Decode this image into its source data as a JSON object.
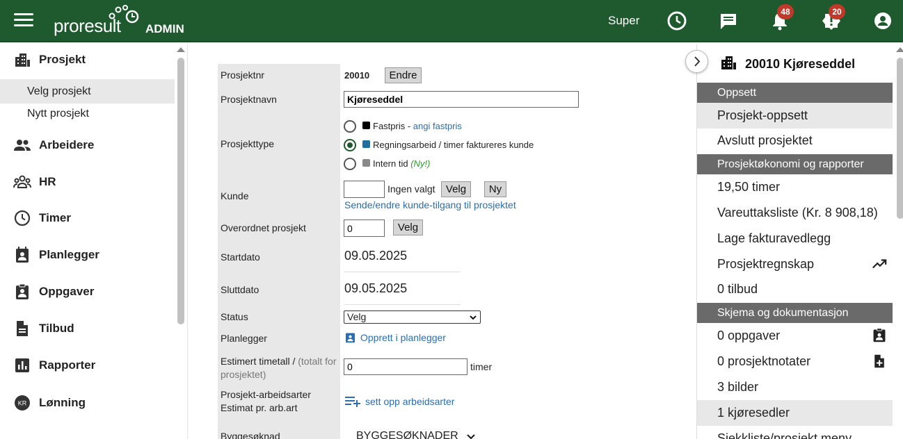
{
  "topbar": {
    "logo_text": "proresult",
    "logo_suffix": "ADMIN",
    "user": "Super",
    "notifications_count": "48",
    "alerts_count": "20"
  },
  "sidebar": {
    "items": [
      {
        "label": "Prosjekt",
        "icon": "building-icon"
      },
      {
        "label": "Arbeidere",
        "icon": "people-icon"
      },
      {
        "label": "HR",
        "icon": "group-icon"
      },
      {
        "label": "Timer",
        "icon": "clock-icon"
      },
      {
        "label": "Planlegger",
        "icon": "contact-calendar-icon"
      },
      {
        "label": "Oppgaver",
        "icon": "clipboard-user-icon"
      },
      {
        "label": "Tilbud",
        "icon": "document-icon"
      },
      {
        "label": "Rapporter",
        "icon": "bar-chart-icon"
      },
      {
        "label": "Lønning",
        "icon": "kr-coin-icon"
      }
    ],
    "subitems": [
      {
        "label": "Velg prosjekt",
        "active": true
      },
      {
        "label": "Nytt prosjekt",
        "active": false
      }
    ]
  },
  "form": {
    "prosjektnr_label": "Prosjektnr",
    "prosjektnr_value": "20010",
    "endre_button": "Endre",
    "prosjektnavn_label": "Prosjektnavn",
    "prosjektnavn_value": "Kjøreseddel",
    "prosjekttype_label": "Prosjekttype",
    "type_options": [
      {
        "label": "Fastpris",
        "sep": " - ",
        "link": "angi fastpris",
        "color": "#000000",
        "selected": false
      },
      {
        "label": "Regningsarbeid / timer faktureres kunde",
        "color": "#1f6f9f",
        "selected": true
      },
      {
        "label": "Intern tid",
        "note": "(Ny!)",
        "color": "#8a8a8a",
        "selected": false
      }
    ],
    "kunde_label": "Kunde",
    "kunde_value": "",
    "kunde_none": "Ingen valgt",
    "velg_button": "Velg",
    "ny_button": "Ny",
    "kunde_link": "Sende/endre kunde-tilgang til prosjektet",
    "overordnet_label": "Overordnet prosjekt",
    "overordnet_value": "0",
    "overordnet_velg": "Velg",
    "startdato_label": "Startdato",
    "startdato_value": "09.05.2025",
    "sluttdato_label": "Sluttdato",
    "sluttdato_value": "09.05.2025",
    "status_label": "Status",
    "status_value": "Velg",
    "planlegger_label": "Planlegger",
    "planlegger_link": "Opprett i planlegger",
    "estimert_label": "Estimert timetall /",
    "estimert_note": "(totalt for prosjektet)",
    "estimert_value": "0",
    "estimert_unit": "timer",
    "arbeidsarter_label_1": "Prosjekt-arbeidsarter",
    "arbeidsarter_label_2": "Estimat pr. arb.art",
    "arbeidsarter_link": "sett opp arbeidsarter",
    "byggesoknad_label": "Byggesøknad",
    "byggesoknad_value": "BYGGESØKNADER"
  },
  "rpanel": {
    "title": "20010 Kjøreseddel",
    "sections": [
      {
        "header": "Oppsett",
        "items": [
          {
            "label": "Prosjekt-oppsett",
            "active": true
          },
          {
            "label": "Avslutt prosjektet"
          }
        ]
      },
      {
        "header": "Prosjektøkonomi og rapporter",
        "items": [
          {
            "label": "19,50 timer"
          },
          {
            "label": "Vareuttaksliste (Kr. 8 908,18)"
          },
          {
            "label": "Lage fakturavedlegg"
          },
          {
            "label": "Prosjektregnskap",
            "icon": "trending-up-icon"
          },
          {
            "label": "0 tilbud"
          }
        ]
      },
      {
        "header": "Skjema og dokumentasjon",
        "items": [
          {
            "label": "0 oppgaver",
            "icon": "clipboard-user-icon"
          },
          {
            "label": "0 prosjektnotater",
            "icon": "note-add-icon"
          },
          {
            "label": "3 bilder"
          },
          {
            "label": "1 kjøresedler",
            "active": true
          },
          {
            "label": "Sjekkliste/prosjekt meny"
          }
        ]
      }
    ]
  },
  "colors": {
    "topbar": "#1e5a2e",
    "badge": "#c0392b",
    "link": "#2a6db0",
    "section_header": "#6a6a6a"
  }
}
